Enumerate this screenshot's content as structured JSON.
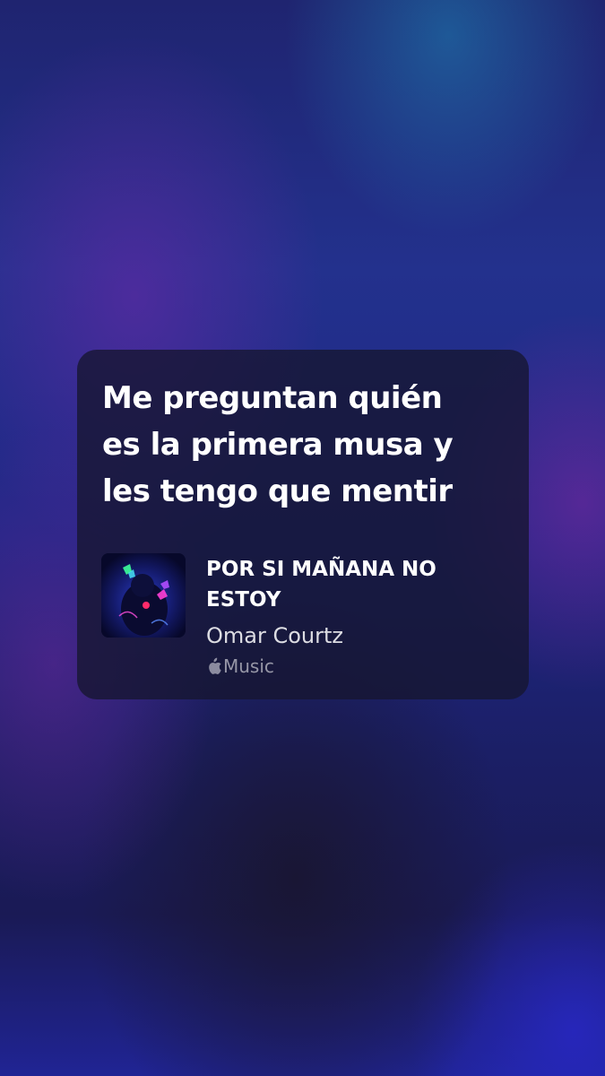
{
  "share_card": {
    "lyrics": [
      "Me preguntan quién",
      "es la primera musa y",
      "les tengo que mentir"
    ],
    "song": {
      "title": "POR SI MAÑANA NO ESTOY",
      "artist": "Omar Courtz",
      "artwork_icon": "album-artwork"
    },
    "service": {
      "icon": "apple-logo-icon",
      "name": "Music"
    }
  },
  "colors": {
    "card_background": "#161630",
    "text_primary": "#ffffff",
    "text_secondary": "#d9d9e0",
    "text_muted": "#8c8ca0"
  }
}
